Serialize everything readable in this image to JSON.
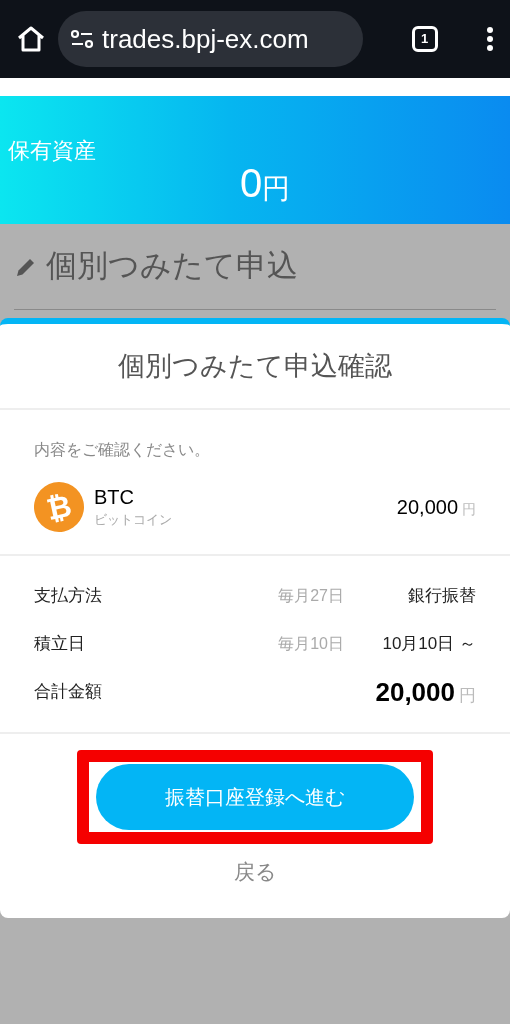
{
  "browser": {
    "url": "trades.bpj-ex.com",
    "tab_count": "1"
  },
  "banner": {
    "label": "保有資産",
    "amount": "0",
    "unit": "円"
  },
  "page_title": "個別つみたて申込",
  "dialog": {
    "title": "個別つみたて申込確認",
    "instruction": "内容をご確認ください。",
    "coin": {
      "icon": "₿",
      "symbol": "BTC",
      "name": "ビットコイン",
      "amount": "20,000",
      "unit": "円"
    },
    "details": [
      {
        "kind": "plain",
        "label": "支払方法",
        "note": "毎月27日",
        "value": "銀行振替"
      },
      {
        "kind": "plain",
        "label": "積立日",
        "note": "毎月10日",
        "value": "10月10日 ～"
      },
      {
        "kind": "total",
        "label": "合計金額",
        "value": "20,000",
        "unit": "円"
      }
    ],
    "primary_button": {
      "label": "振替口座登録へ進む",
      "highlighted": true
    },
    "back_link": "戻る"
  }
}
